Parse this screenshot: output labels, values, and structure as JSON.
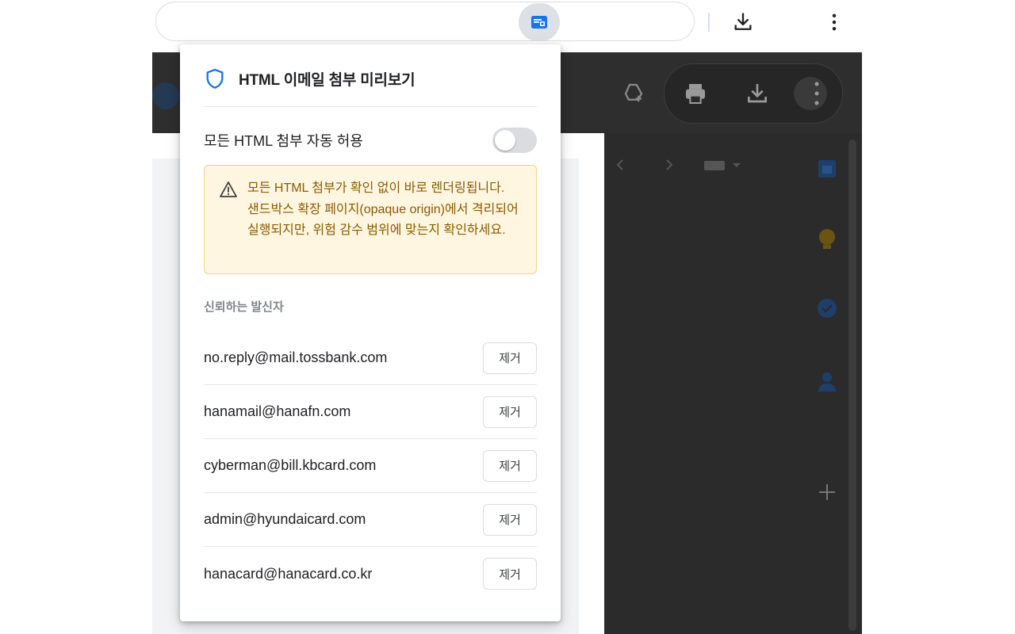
{
  "toolbar": {
    "extension_icon": "html-attachment-extension-icon",
    "download_icon": "download-icon",
    "menu_icon": "kebab-menu-icon"
  },
  "popup": {
    "title": "HTML 이메일 첨부 미리보기",
    "title_icon": "shield-icon",
    "auto_allow_label": "모든 HTML 첨부 자동 허용",
    "auto_allow_enabled": false,
    "warning": {
      "icon": "warning-triangle-icon",
      "text": "모든 HTML 첨부가 확인 없이 바로 렌더링됩니다. 샌드박스 확장 페이지(opaque origin)에서 격리되어 실행되지만, 위험 감수 범위에 맞는지 확인하세요."
    },
    "trusted_senders_label": "신뢰하는 발신자",
    "remove_label": "제거",
    "trusted_senders": [
      "no.reply@mail.tossbank.com",
      "hanamail@hanafn.com",
      "cyberman@bill.kbcard.com",
      "admin@hyundaicard.com",
      "hanacard@hanacard.co.kr"
    ]
  },
  "colors": {
    "accent": "#1a73e8",
    "warning_bg": "#fef6e0",
    "warning_border": "#f0d48a",
    "warning_text": "#8a5a00"
  }
}
